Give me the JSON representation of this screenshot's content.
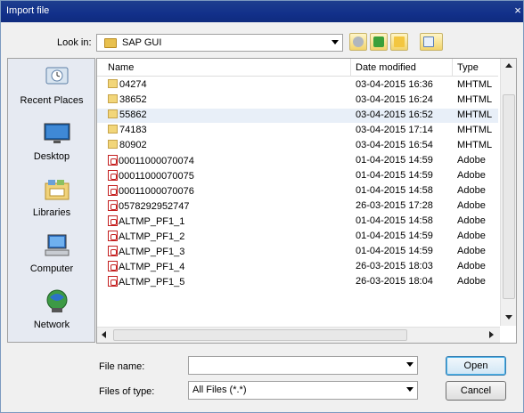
{
  "window": {
    "title": "Import file",
    "close_glyph": "×"
  },
  "lookin": {
    "label": "Look in:",
    "value": "SAP GUI"
  },
  "toolbar": {
    "icons": [
      "back-icon",
      "up-folder-icon",
      "new-folder-icon",
      "view-menu-icon"
    ]
  },
  "places": [
    {
      "name": "Recent Places",
      "icon": "recent-places-icon"
    },
    {
      "name": "Desktop",
      "icon": "desktop-icon"
    },
    {
      "name": "Libraries",
      "icon": "libraries-icon"
    },
    {
      "name": "Computer",
      "icon": "computer-icon"
    },
    {
      "name": "Network",
      "icon": "network-icon"
    }
  ],
  "columns": {
    "name": "Name",
    "date": "Date modified",
    "type": "Type"
  },
  "files": [
    {
      "name": "04274",
      "date": "03-04-2015 16:36",
      "type": "MHTML",
      "kind": "folder"
    },
    {
      "name": "38652",
      "date": "03-04-2015 16:24",
      "type": "MHTML",
      "kind": "folder"
    },
    {
      "name": "55862",
      "date": "03-04-2015 16:52",
      "type": "MHTML",
      "kind": "folder"
    },
    {
      "name": "74183",
      "date": "03-04-2015 17:14",
      "type": "MHTML",
      "kind": "folder"
    },
    {
      "name": "80902",
      "date": "03-04-2015 16:54",
      "type": "MHTML",
      "kind": "folder"
    },
    {
      "name": "00011000070074",
      "date": "01-04-2015 14:59",
      "type": "Adobe",
      "kind": "pdf"
    },
    {
      "name": "00011000070075",
      "date": "01-04-2015 14:59",
      "type": "Adobe",
      "kind": "pdf"
    },
    {
      "name": "00011000070076",
      "date": "01-04-2015 14:58",
      "type": "Adobe",
      "kind": "pdf"
    },
    {
      "name": "0578292952747",
      "date": "26-03-2015 17:28",
      "type": "Adobe",
      "kind": "pdf"
    },
    {
      "name": "ALTMP_PF1_1",
      "date": "01-04-2015 14:58",
      "type": "Adobe",
      "kind": "pdf"
    },
    {
      "name": "ALTMP_PF1_2",
      "date": "01-04-2015 14:59",
      "type": "Adobe",
      "kind": "pdf"
    },
    {
      "name": "ALTMP_PF1_3",
      "date": "01-04-2015 14:59",
      "type": "Adobe",
      "kind": "pdf"
    },
    {
      "name": "ALTMP_PF1_4",
      "date": "26-03-2015 18:03",
      "type": "Adobe",
      "kind": "pdf"
    },
    {
      "name": "ALTMP_PF1_5",
      "date": "26-03-2015 18:04",
      "type": "Adobe",
      "kind": "pdf"
    }
  ],
  "filename": {
    "label": "File name:",
    "value": ""
  },
  "filetype": {
    "label": "Files of type:",
    "value": "All Files (*.*)"
  },
  "buttons": {
    "open": "Open",
    "cancel": "Cancel"
  }
}
